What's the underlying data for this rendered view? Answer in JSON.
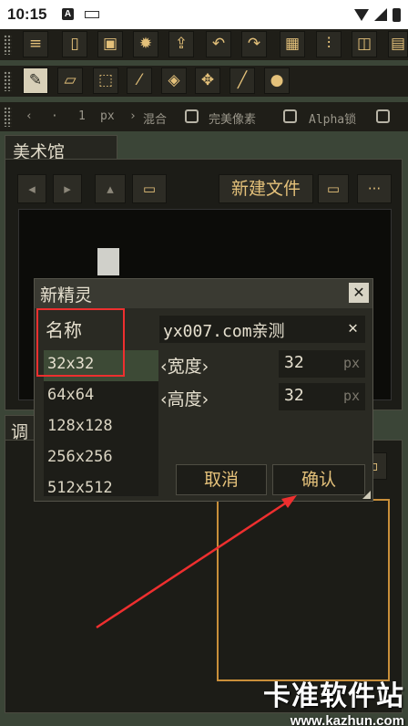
{
  "status_bar": {
    "time": "10:15",
    "notification_icon": "A"
  },
  "tools_row1": [
    "settings-sliders",
    "new-file",
    "save",
    "gear",
    "export",
    "undo",
    "redo",
    "grid",
    "adjust",
    "flip",
    "more"
  ],
  "tools_row2": [
    "pencil",
    "eraser",
    "selection",
    "eyedropper",
    "fill-bucket",
    "move",
    "line",
    "smudge"
  ],
  "options": {
    "size_value": "1",
    "size_unit": "px",
    "blend_label": "混合",
    "perfect_pixel_label": "完美像素",
    "alpha_lock_label": "Alpha锁"
  },
  "gallery": {
    "tab_label": "美术馆",
    "new_file_label": "新建文件"
  },
  "adjust": {
    "tab_label": "调"
  },
  "dialog": {
    "title": "新精灵",
    "name_label": "名称",
    "name_value": "yx007.com亲测",
    "sizes": [
      "32x32",
      "64x64",
      "128x128",
      "256x256",
      "512x512"
    ],
    "selected_size": "32x32",
    "width_label": "‹宽度›",
    "width_value": "32",
    "height_label": "‹高度›",
    "height_value": "32",
    "unit": "px",
    "cancel_label": "取消",
    "confirm_label": "确认"
  },
  "watermark": {
    "main": "卡准软件站",
    "sub": "www.kazhun.com"
  }
}
